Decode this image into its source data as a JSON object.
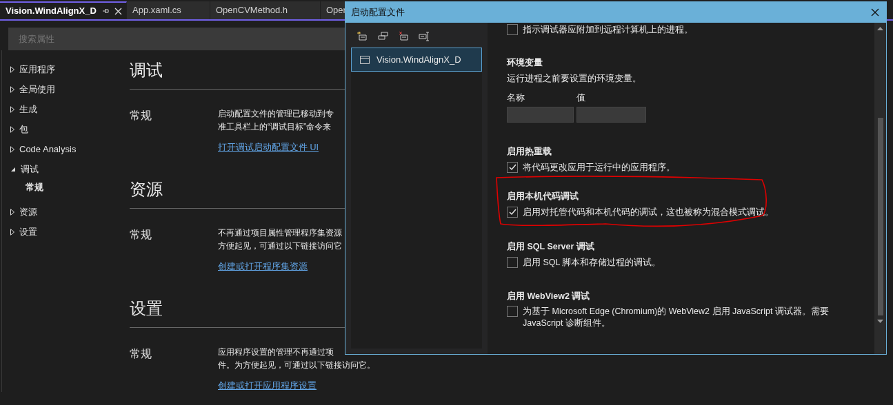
{
  "tabs": [
    {
      "label": "Vision.WindAlignX_D",
      "selected": true
    },
    {
      "label": "App.xaml.cs",
      "selected": false
    },
    {
      "label": "OpenCVMethod.h",
      "selected": false
    },
    {
      "label": "Oper",
      "selected": false
    }
  ],
  "search": {
    "placeholder": "搜索属性"
  },
  "sidebar": {
    "items": [
      {
        "label": "应用程序",
        "expanded": false
      },
      {
        "label": "全局使用",
        "expanded": false
      },
      {
        "label": "生成",
        "expanded": false
      },
      {
        "label": "包",
        "expanded": false
      },
      {
        "label": "Code Analysis",
        "expanded": false
      },
      {
        "label": "调试",
        "expanded": true,
        "children": [
          {
            "label": "常规"
          }
        ]
      },
      {
        "label": "资源",
        "expanded": false
      },
      {
        "label": "设置",
        "expanded": false
      }
    ]
  },
  "sections": [
    {
      "title": "调试",
      "groups": [
        {
          "label": "常规",
          "lines": [
            "启动配置文件的管理已移动到专",
            "准工具栏上的“调试目标”命令来"
          ],
          "link": "打开调试启动配置文件 UI"
        }
      ]
    },
    {
      "title": "资源",
      "groups": [
        {
          "label": "常规",
          "lines": [
            "不再通过项目属性管理程序集资源",
            "方便起见，可通过以下链接访问它"
          ],
          "link": "创建或打开程序集资源"
        }
      ]
    },
    {
      "title": "设置",
      "groups": [
        {
          "label": "常规",
          "lines": [
            "应用程序设置的管理不再通过项",
            "件。为方便起见，可通过以下链接访问它。"
          ],
          "link": "创建或打开应用程序设置"
        }
      ]
    }
  ],
  "dialog": {
    "title": "启动配置文件",
    "profiles": [
      {
        "label": "Vision.WindAlignX_D",
        "selected": true
      }
    ],
    "blocks": [
      {
        "kind": "checkbox",
        "text": "指示调试器应附加到远程计算机上的进程。",
        "checked": false
      },
      {
        "kind": "env",
        "title": "环境变量",
        "description": "运行进程之前要设置的环境变量。",
        "columns": [
          "名称",
          "值"
        ]
      },
      {
        "kind": "option",
        "title": "启用热重载",
        "text": "将代码更改应用于运行中的应用程序。",
        "checked": true,
        "highlighted": false
      },
      {
        "kind": "option",
        "title": "启用本机代码调试",
        "text": "启用对托管代码和本机代码的调试，这也被称为混合模式调试。",
        "checked": true,
        "highlighted": true
      },
      {
        "kind": "option",
        "title": "启用 SQL Server 调试",
        "text": "启用 SQL 脚本和存储过程的调试。",
        "checked": false,
        "highlighted": false
      },
      {
        "kind": "option",
        "title": "启用 WebView2 调试",
        "text": "为基于 Microsoft Edge (Chromium)的 WebView2 启用 JavaScript 调试器。需要 JavaScript 诊断组件。",
        "checked": false,
        "highlighted": false
      }
    ]
  }
}
